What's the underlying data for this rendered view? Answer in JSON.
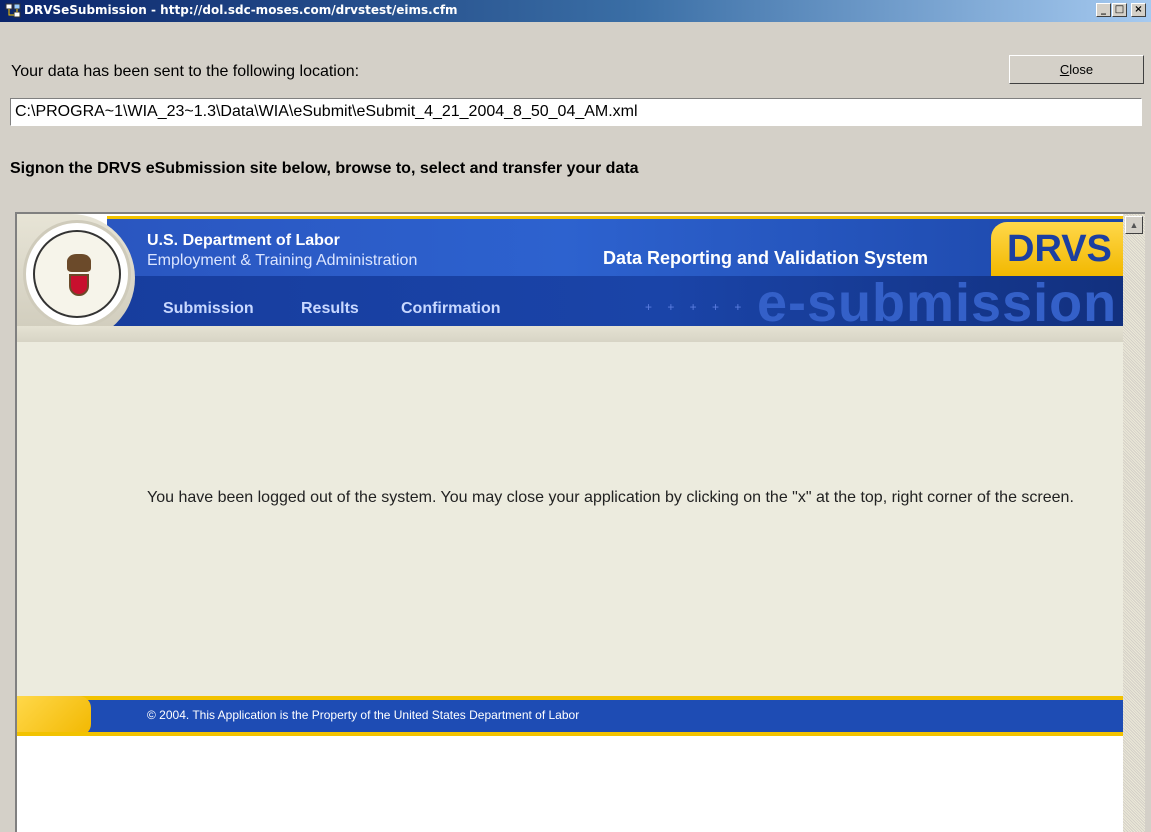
{
  "window": {
    "title": "DRVSeSubmission - http://dol.sdc-moses.com/drvstest/eims.cfm",
    "controls": {
      "minimize": "_",
      "maximize": "□",
      "close": "×"
    }
  },
  "message": "Your data has been sent to the following location:",
  "close_button": {
    "label_accel": "C",
    "label_rest": "lose"
  },
  "path_value": "C:\\PROGRA~1\\WIA_23~1.3\\Data\\WIA\\eSubmit\\eSubmit_4_21_2004_8_50_04_AM.xml",
  "signon_text": "Signon the DRVS eSubmission site below, browse to, select and transfer your data",
  "web": {
    "agency_line1": "U.S. Department of Labor",
    "agency_line2": "Employment & Training Administration",
    "system_title": "Data Reporting and Validation System",
    "badge": "DRVS",
    "wordmark": "e-submission",
    "nav": [
      "Submission",
      "Results",
      "Confirmation"
    ],
    "logout_text": "You have been logged out of the system. You may close your application by clicking on the \"x\" at the top, right corner of the screen.",
    "footer_text": "© 2004. This Application is the Property of the United States Department of Labor"
  },
  "colors": {
    "titlebar": "#0a246a",
    "dol_blue": "#1e4cb4",
    "dol_gold": "#f2c200"
  }
}
